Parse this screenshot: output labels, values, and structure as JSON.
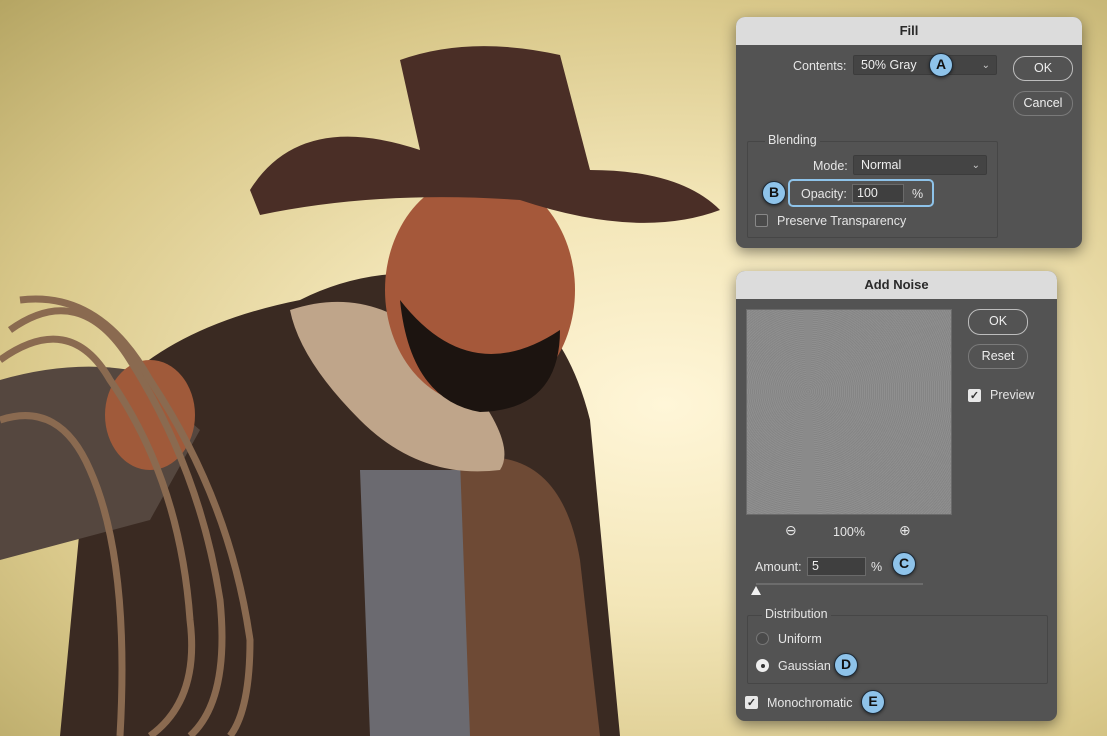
{
  "fill": {
    "title": "Fill",
    "contents_label": "Contents:",
    "contents_value": "50% Gray",
    "ok": "OK",
    "cancel": "Cancel",
    "blending_label": "Blending",
    "mode_label": "Mode:",
    "mode_value": "Normal",
    "opacity_label": "Opacity:",
    "opacity_value": "100",
    "opacity_unit": "%",
    "preserve_label": "Preserve Transparency",
    "preserve_checked": false
  },
  "noise": {
    "title": "Add Noise",
    "ok": "OK",
    "reset": "Reset",
    "preview_label": "Preview",
    "preview_checked": true,
    "zoom_value": "100%",
    "amount_label": "Amount:",
    "amount_value": "5",
    "amount_unit": "%",
    "distribution_label": "Distribution",
    "uniform_label": "Uniform",
    "gaussian_label": "Gaussian",
    "selected_distribution": "Gaussian",
    "mono_label": "Monochromatic",
    "mono_checked": true
  },
  "badges": [
    "A",
    "B",
    "C",
    "D",
    "E"
  ],
  "colors": {
    "badge": "#8ec3ea",
    "dialog": "#535353",
    "titlebar": "#dcdcdc"
  }
}
